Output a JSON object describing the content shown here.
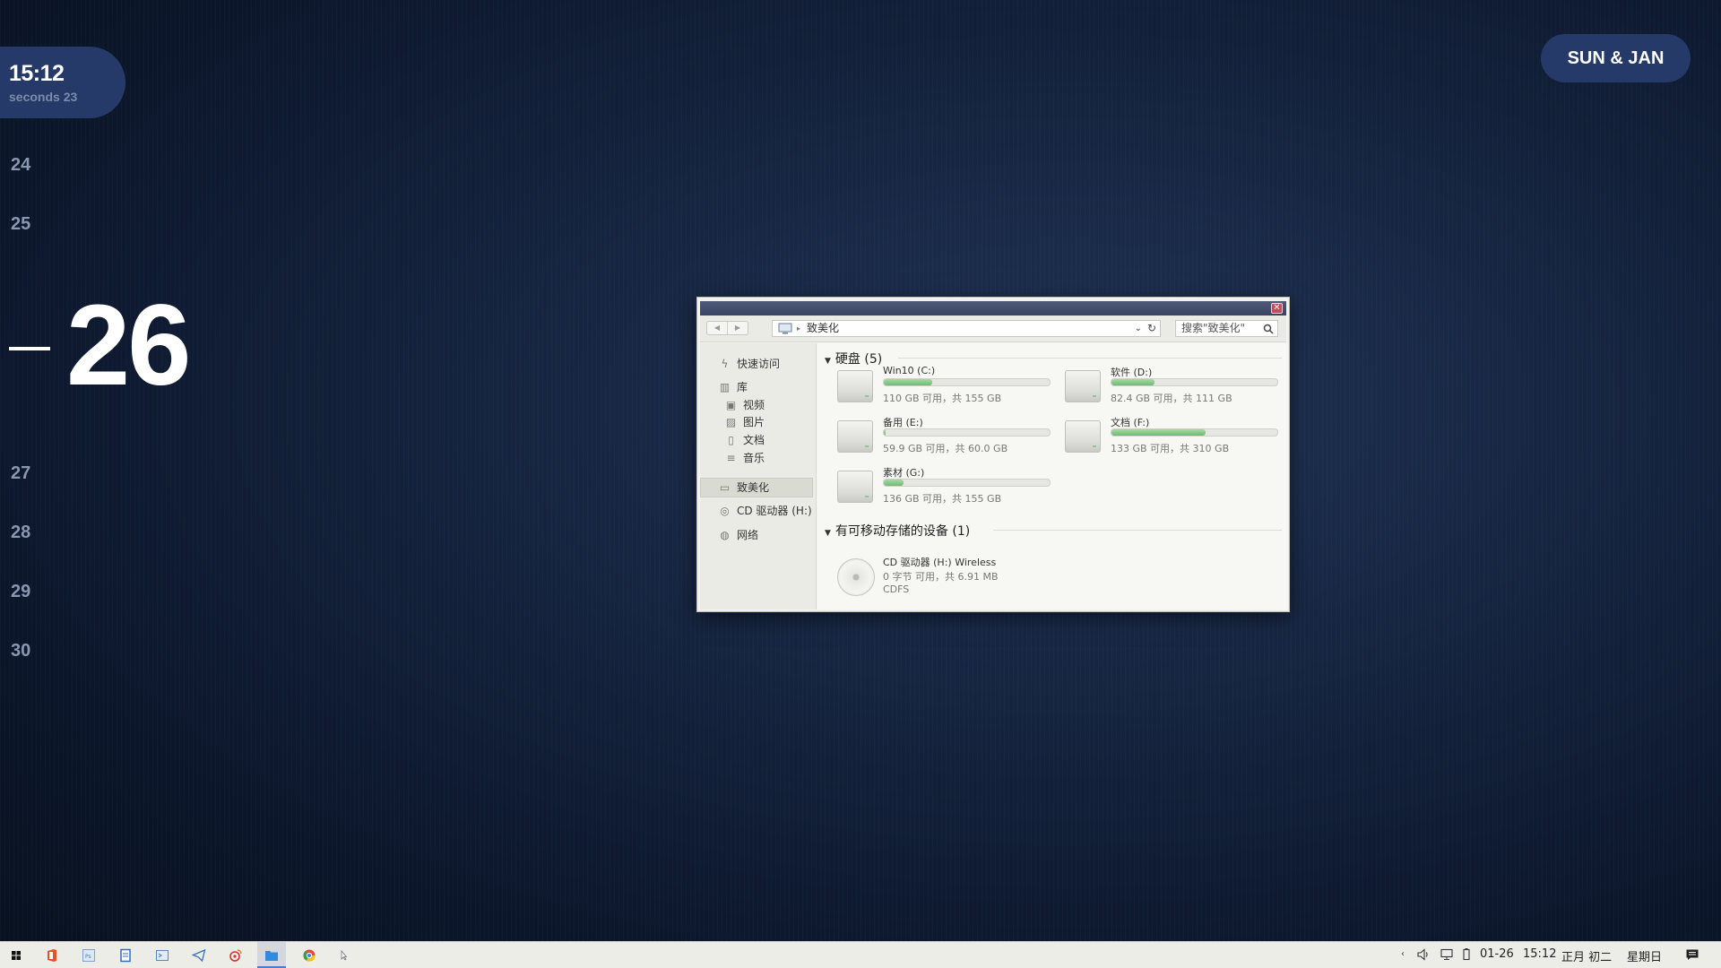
{
  "desktop": {
    "clock": {
      "time": "15:12",
      "seconds": "seconds 23"
    },
    "date_badge": "SUN & JAN",
    "days": {
      "above": [
        "24",
        "25"
      ],
      "current": "26",
      "below": [
        "27",
        "28",
        "29",
        "30"
      ]
    }
  },
  "explorer": {
    "address_path": "致美化",
    "search_placeholder": "搜索\"致美化\"",
    "sidebar": {
      "quick_access": "快速访问",
      "library": "库",
      "videos": "视频",
      "pictures": "图片",
      "documents": "文档",
      "music": "音乐",
      "this_pc": "致美化",
      "cd_drive": "CD 驱动器 (H:)",
      "network": "网络"
    },
    "hard_disks": {
      "header": "硬盘 (5)",
      "drives": [
        {
          "name": "Win10 (C:)",
          "info": "110 GB 可用，共 155 GB",
          "used_fraction": 0.29
        },
        {
          "name": "软件 (D:)",
          "info": "82.4 GB 可用，共 111 GB",
          "used_fraction": 0.26
        },
        {
          "name": "备用 (E:)",
          "info": "59.9 GB 可用，共 60.0 GB",
          "used_fraction": 0.01
        },
        {
          "name": "文档 (F:)",
          "info": "133 GB 可用，共 310 GB",
          "used_fraction": 0.57
        },
        {
          "name": "素材 (G:)",
          "info": "136 GB 可用，共 155 GB",
          "used_fraction": 0.12
        }
      ]
    },
    "removable": {
      "header": "有可移动存储的设备 (1)",
      "cd": {
        "name": "CD 驱动器 (H:) Wireless",
        "info": "0 字节 可用，共 6.91 MB",
        "fs": "CDFS"
      }
    }
  },
  "taskbar": {
    "pinned_icons": [
      "start-icon",
      "office-icon",
      "photoshop-icon",
      "notepad-icon",
      "terminal-icon",
      "telegram-icon",
      "weibo-icon",
      "file-explorer-icon",
      "chrome-icon",
      "pointer-icon"
    ],
    "tray": {
      "date": "01-26",
      "time": "15:12",
      "lunar": "正月 初二",
      "weekday": "星期日"
    }
  },
  "colors": {
    "accent_pill": "#253a68",
    "progress_green": "#6fba72",
    "background": "#15243f"
  }
}
